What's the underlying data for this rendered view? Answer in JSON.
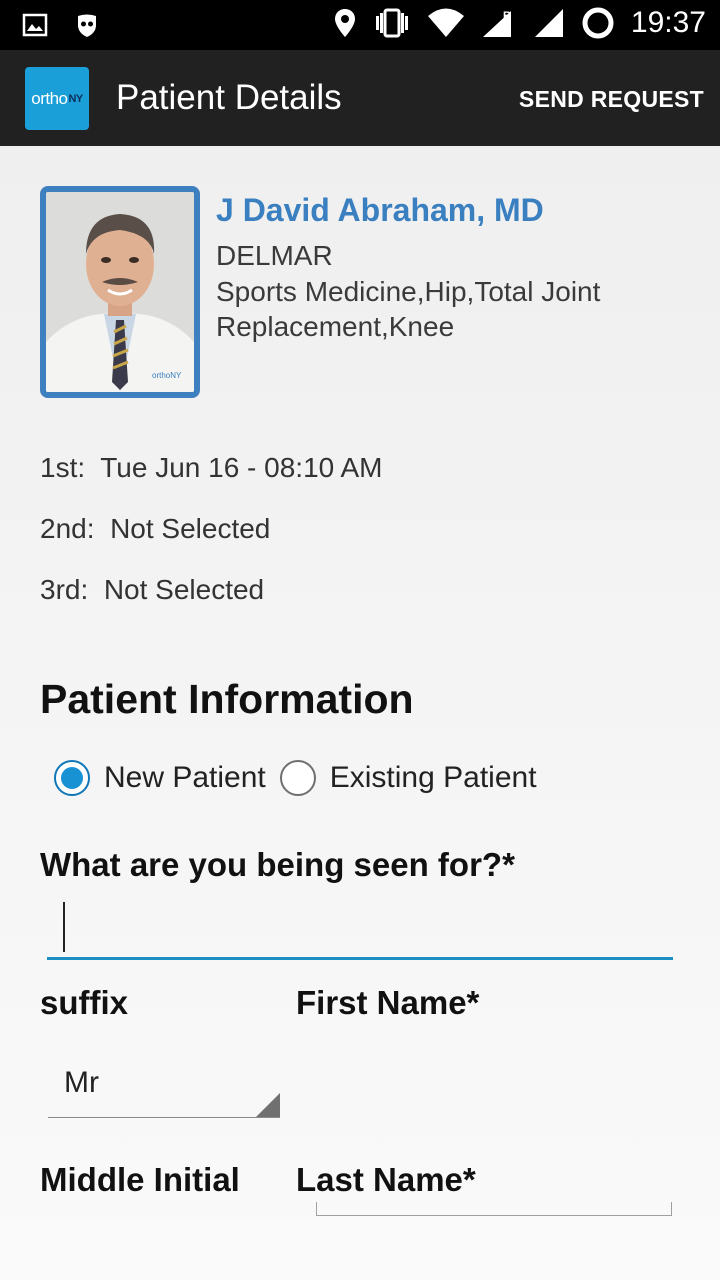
{
  "status_bar": {
    "time": "19:37",
    "icons": [
      "image-icon",
      "privacy-icon",
      "location-icon",
      "vibrate-icon",
      "wifi-icon",
      "signal-roaming-icon",
      "signal-icon",
      "battery-loading-icon"
    ]
  },
  "app_bar": {
    "logo_text": "ortho",
    "logo_suffix": "NY",
    "title": "Patient Details",
    "action_label": "SEND REQUEST"
  },
  "doctor": {
    "name": "J David Abraham, MD",
    "location": "DELMAR",
    "specialties": "Sports Medicine,Hip,Total Joint Replacement,Knee",
    "photo_badge": "orthoNY"
  },
  "appointments": [
    {
      "label": "1st:",
      "value": "Tue Jun 16 - 08:10 AM"
    },
    {
      "label": "2nd:",
      "value": "Not Selected"
    },
    {
      "label": "3rd:",
      "value": "Not Selected"
    }
  ],
  "patient_info": {
    "title": "Patient Information",
    "options": [
      {
        "label": "New Patient",
        "selected": true
      },
      {
        "label": "Existing Patient",
        "selected": false
      }
    ],
    "reason_label": "What are you being seen for?*",
    "reason_value": "",
    "suffix_label": "suffix",
    "suffix_value": "Mr",
    "first_name_label": "First Name*",
    "first_name_value": "",
    "middle_initial_label": "Middle Initial",
    "last_name_label": "Last Name*"
  },
  "colors": {
    "accent": "#1992d4",
    "doctor_name": "#3a7fc0",
    "app_bar": "#212121",
    "logo_bg": "#1a9fd8"
  }
}
